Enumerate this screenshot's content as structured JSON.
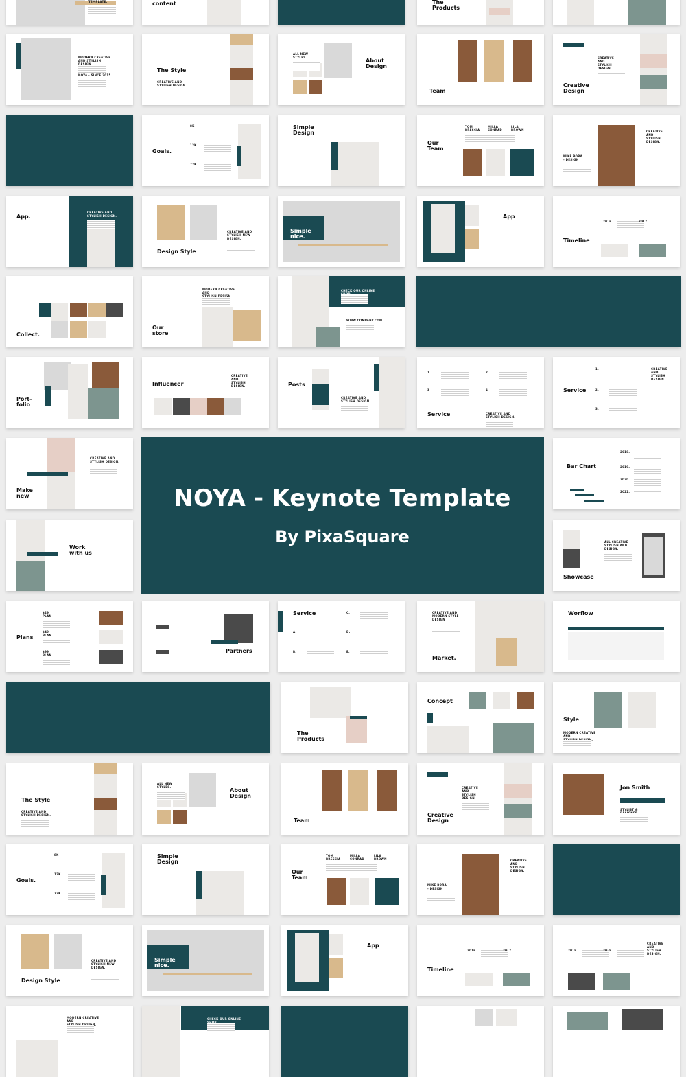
{
  "hero": {
    "title": "NOYA - Keynote Template",
    "subtitle": "By PixaSquare"
  },
  "colors": {
    "accent": "#1a4a52",
    "background": "#ededed"
  },
  "slides": [
    {
      "title": "",
      "labels": [
        "TEMPLATE."
      ]
    },
    {
      "title": "content",
      "labels": []
    },
    {
      "title": "",
      "labels": []
    },
    {
      "title": "The\nProducts",
      "labels": []
    },
    {
      "title": "",
      "labels": []
    },
    {
      "title": "",
      "labels": [
        "MODERN CREATIVE\nAND STYLISH DESIGN.",
        "NOYA · SINCE 2015"
      ]
    },
    {
      "title": "The Style",
      "labels": [
        "CREATIVE AND\nSTYLISH DESIGN."
      ]
    },
    {
      "title": "About\nDesign",
      "labels": [
        "ALL NEW\nSTYLES."
      ]
    },
    {
      "title": "Team",
      "labels": []
    },
    {
      "title": "Creative\nDesign",
      "labels": [
        "CREATIVE\nAND\nSTYLISH\nDESIGN."
      ]
    },
    {
      "title": "",
      "labels": []
    },
    {
      "title": "Goals.",
      "labels": [
        "8K",
        "12K",
        "72K"
      ]
    },
    {
      "title": "Simple\nDesign",
      "labels": []
    },
    {
      "title": "Our\nTeam",
      "labels": [
        "TOM\nBRESCIA",
        "MILLA\nCONRAD",
        "LILA\nBROWN"
      ]
    },
    {
      "title": "",
      "labels": [
        "MIKE BORA\n- DESIGN",
        "CREATIVE\nAND\nSTYLISH\nDESIGN."
      ]
    },
    {
      "title": "App.",
      "labels": [
        "CREATIVE AND\nSTYLISH DESIGN."
      ]
    },
    {
      "title": "Design Style",
      "labels": [
        "CREATIVE AND\nSTYLISH NEW\nDESIGN."
      ]
    },
    {
      "title": "Simple\nnice.",
      "labels": []
    },
    {
      "title": "App",
      "labels": []
    },
    {
      "title": "Timeline",
      "labels": [
        "2016.",
        "2017."
      ]
    },
    {
      "title": "Collect.",
      "labels": []
    },
    {
      "title": "Our\nstore",
      "labels": [
        "MODERN CREATIVE AND\nSTYLISH DESIGN."
      ]
    },
    {
      "title": "",
      "labels": [
        "CHECK OUR ONLINE SHOP",
        "WWW.COMPANY.COM"
      ]
    },
    {
      "title": "",
      "labels": []
    },
    {
      "title": "Port-\nfolio",
      "labels": []
    },
    {
      "title": "Influencer",
      "labels": [
        "CREATIVE\nAND\nSTYLISH\nDESIGN."
      ]
    },
    {
      "title": "Posts",
      "labels": [
        "CREATIVE AND\nSTYLISH DESIGN."
      ]
    },
    {
      "title": "Service",
      "labels": [
        "1",
        "2",
        "3",
        "4",
        "CREATIVE AND\nSTYLISH DESIGN."
      ]
    },
    {
      "title": "Service",
      "labels": [
        "1.",
        "2.",
        "3.",
        "CREATIVE\nAND\nSTYLISH\nDESIGN."
      ]
    },
    {
      "title": "Make\nnew",
      "labels": [
        "CREATIVE AND\nSTYLISH DESIGN."
      ]
    },
    {
      "title": "Bar Chart",
      "labels": [
        "2018.",
        "2019.",
        "2020.",
        "2022."
      ]
    },
    {
      "title": "Work\nwith us",
      "labels": []
    },
    {
      "title": "Showcase",
      "labels": [
        "ALL CREATIVE\nSTYLISH AND\nDESIGN."
      ]
    },
    {
      "title": "Plans",
      "labels": [
        "$29\nPLAN",
        "$49\nPLAN",
        "$99\nPLAN"
      ]
    },
    {
      "title": "Partners",
      "labels": []
    },
    {
      "title": "Service",
      "labels": [
        "A.",
        "B.",
        "C.",
        "D.",
        "E."
      ]
    },
    {
      "title": "Market.",
      "labels": [
        "CREATIVE AND\nMODERN STYLE\nDESIGN"
      ]
    },
    {
      "title": "Worflow",
      "labels": []
    },
    {
      "title": "",
      "labels": []
    },
    {
      "title": "The\nProducts",
      "labels": []
    },
    {
      "title": "Concept",
      "labels": []
    },
    {
      "title": "Style",
      "labels": [
        "MODERN CREATIVE AND\nSTYLISH DESIGN."
      ]
    },
    {
      "title": "The Style",
      "labels": [
        "CREATIVE AND\nSTYLISH DESIGN."
      ]
    },
    {
      "title": "About\nDesign",
      "labels": [
        "ALL NEW\nSTYLES."
      ]
    },
    {
      "title": "Team",
      "labels": []
    },
    {
      "title": "Creative\nDesign",
      "labels": [
        "CREATIVE\nAND\nSTYLISH\nDESIGN."
      ]
    },
    {
      "title": "Jon Smith",
      "labels": [
        "STYLIST & DESIGNER"
      ]
    },
    {
      "title": "Goals.",
      "labels": [
        "8K",
        "12K",
        "72K"
      ]
    },
    {
      "title": "Simple\nDesign",
      "labels": []
    },
    {
      "title": "Our\nTeam",
      "labels": [
        "TOM\nBRESCIA",
        "MILLA\nCONRAD",
        "LILA\nBROWN"
      ]
    },
    {
      "title": "",
      "labels": [
        "MIKE BORA\n- DESIGN",
        "CREATIVE\nAND\nSTYLISH\nDESIGN."
      ]
    },
    {
      "title": "",
      "labels": []
    },
    {
      "title": "Design Style",
      "labels": [
        "CREATIVE AND\nSTYLISH NEW\nDESIGN."
      ]
    },
    {
      "title": "Simple\nnice.",
      "labels": []
    },
    {
      "title": "App",
      "labels": []
    },
    {
      "title": "Timeline",
      "labels": [
        "2016.",
        "2017."
      ]
    },
    {
      "title": "",
      "labels": [
        "2018.",
        "2019.",
        "CREATIVE\nAND\nSTYLISH\nDESIGN."
      ]
    },
    {
      "title": "",
      "labels": [
        "MODERN CREATIVE AND\nSTYLISH DESIGN."
      ]
    },
    {
      "title": "",
      "labels": [
        "CHECK OUR ONLINE SHOP"
      ]
    },
    {
      "title": "",
      "labels": []
    },
    {
      "title": "",
      "labels": []
    },
    {
      "title": "",
      "labels": []
    }
  ]
}
